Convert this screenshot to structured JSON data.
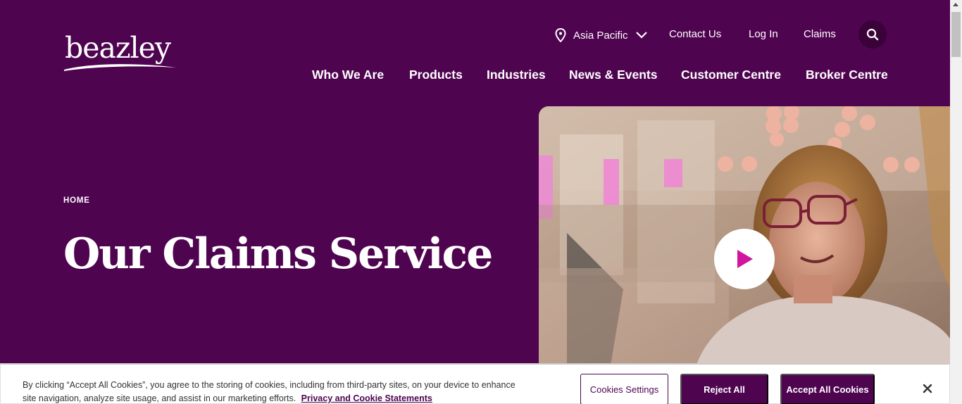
{
  "brand": {
    "logo_text": "beazley"
  },
  "utility_nav": {
    "region": "Asia Pacific",
    "contact": "Contact Us",
    "login": "Log In",
    "claims": "Claims"
  },
  "main_nav": {
    "items": [
      "Who We Are",
      "Products",
      "Industries",
      "News & Events",
      "Customer Centre",
      "Broker Centre"
    ]
  },
  "hero": {
    "breadcrumb": "HOME",
    "title": "Our Claims Service"
  },
  "video": {
    "play_icon": "play-icon"
  },
  "cookie_banner": {
    "text": "By clicking “Accept All Cookies”, you agree to the storing of cookies, including from third-party sites, on your device to enhance site navigation, analyze site usage, and assist in our marketing efforts.",
    "link": "Privacy and Cookie Statements",
    "settings_label": "Cookies Settings",
    "reject_label": "Reject All",
    "accept_label": "Accept All Cookies"
  },
  "colors": {
    "brand_purple": "#4f0450",
    "play_magenta": "#d0159e"
  }
}
